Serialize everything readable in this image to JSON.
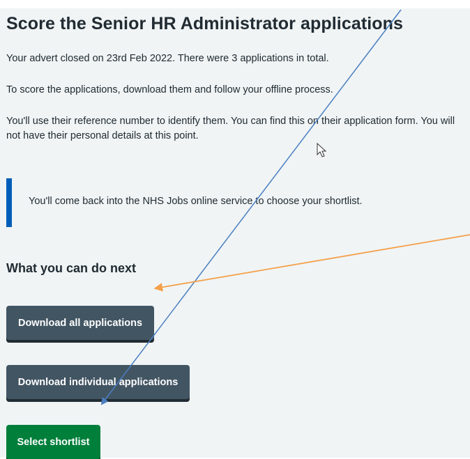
{
  "page": {
    "title": "Score the Senior HR Administrator applications",
    "paragraphs": [
      "Your advert closed on 23rd Feb 2022. There were 3 applications in total.",
      "To score the applications, download them and follow your offline process.",
      "You'll use their reference number to identify them. You can find this on their application form. You will not have their personal details at this point."
    ],
    "inset_text": "You'll come back into the NHS Jobs online service to choose your shortlist.",
    "next_heading": "What you can do next",
    "buttons": {
      "download_all": "Download all applications",
      "download_individual": "Download individual applications",
      "select_shortlist": "Select shortlist"
    }
  },
  "colors": {
    "page_background": "#f0f4f5",
    "text": "#212b32",
    "inset_bar": "#005eb8",
    "secondary_button": "#425563",
    "primary_button": "#007f3b",
    "annotation_blue_arrow": "#4a7fc1",
    "annotation_orange_arrow": "#f5a04a"
  }
}
